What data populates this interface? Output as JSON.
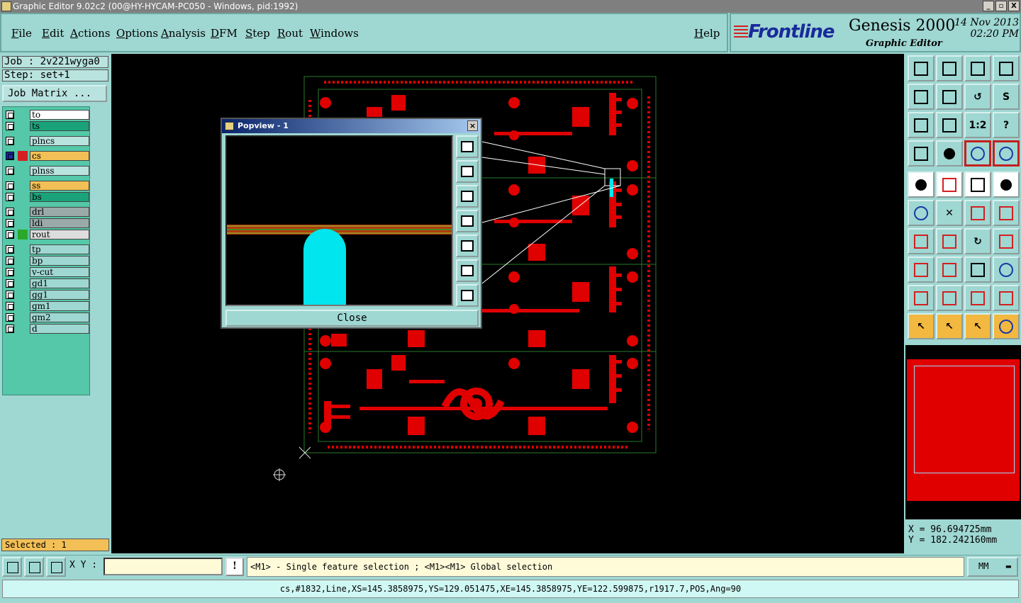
{
  "window": {
    "title": "Graphic Editor 9.02c2 (00@HY-HYCAM-PC050 - Windows, pid:1992)",
    "min": "_",
    "max": "▫",
    "close": "X"
  },
  "menu": {
    "file": "File",
    "edit": "Edit",
    "actions": "Actions",
    "options": "Options",
    "analysis": "Analysis",
    "dfm": "DFM",
    "step": "Step",
    "rout": "Rout",
    "windows": "Windows",
    "help": "Help"
  },
  "brand": {
    "logo": "Frontline",
    "product": "Genesis 2000",
    "subtitle": "Graphic Editor",
    "date": "14 Nov 2013",
    "time": "02:20 PM"
  },
  "job": {
    "job": "Job : 2v221wyga0",
    "step": "Step: set+1",
    "matrix_button": "Job Matrix ..."
  },
  "layers": [
    {
      "name": "to",
      "color": "#ffffff"
    },
    {
      "name": "ts",
      "color": "#1aa37a"
    },
    {
      "name": "plncs",
      "color": "#b9e3df"
    },
    {
      "name": "cs",
      "color": "#f2c056"
    },
    {
      "name": "plnss",
      "color": "#b9e3df"
    },
    {
      "name": "ss",
      "color": "#f2c056"
    },
    {
      "name": "bs",
      "color": "#1aa37a"
    },
    {
      "name": "drl",
      "color": "#9aaaa8"
    },
    {
      "name": "ldi",
      "color": "#9aaaa8"
    },
    {
      "name": "rout",
      "color": "#dddddd"
    },
    {
      "name": "tp",
      "color": "#9fd7d2"
    },
    {
      "name": "bp",
      "color": "#9fd7d2"
    },
    {
      "name": "v-cut",
      "color": "#9fd7d2"
    },
    {
      "name": "gd1",
      "color": "#9fd7d2"
    },
    {
      "name": "gg1",
      "color": "#9fd7d2"
    },
    {
      "name": "gm1",
      "color": "#9fd7d2"
    },
    {
      "name": "gm2",
      "color": "#9fd7d2"
    },
    {
      "name": "d",
      "color": "#9fd7d2"
    }
  ],
  "selected": "Selected : 1",
  "popview": {
    "title": "Popview - 1",
    "close": "Close"
  },
  "coords": {
    "x": "X =  96.694725mm",
    "y": "Y = 182.242160mm"
  },
  "bottom": {
    "xy_label": "X Y :",
    "warn": "!",
    "prompt": "<M1> - Single feature selection ; <M1><M1> Global selection",
    "units": "MM"
  },
  "status": "cs,#1832,Line,XS=145.3858975,YS=129.051475,XE=145.3858975,YE=122.599875,r1917.7,POS,Ang=90",
  "colors": {
    "copper": "#e00000",
    "panel": "#9fd7d2",
    "highlight": "#00e5ee"
  }
}
